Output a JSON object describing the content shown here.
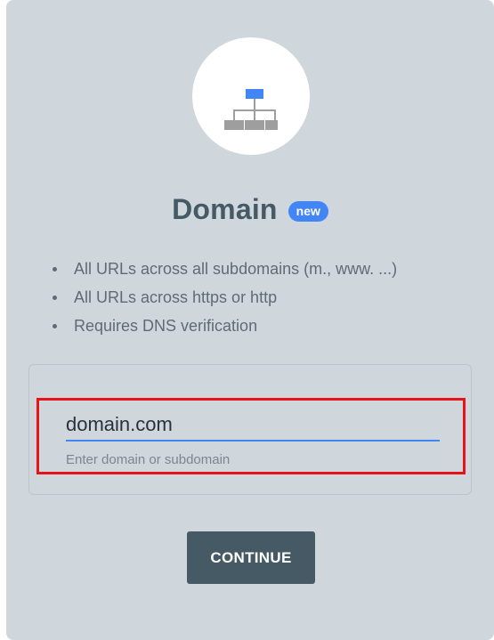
{
  "property": {
    "title": "Domain",
    "badge": "new",
    "icon": "sitemap-icon",
    "features": [
      "All URLs across all subdomains (m., www. ...)",
      "All URLs across https or http",
      "Requires DNS verification"
    ],
    "input": {
      "value": "domain.com",
      "helper_text": "Enter domain or subdomain"
    },
    "continue_label": "CONTINUE"
  },
  "colors": {
    "card_background": "#d0d7dc",
    "title": "#455a64",
    "badge": "#4285f4",
    "underline": "#4285f4",
    "button": "#455a64",
    "highlight": "#e8131a"
  }
}
